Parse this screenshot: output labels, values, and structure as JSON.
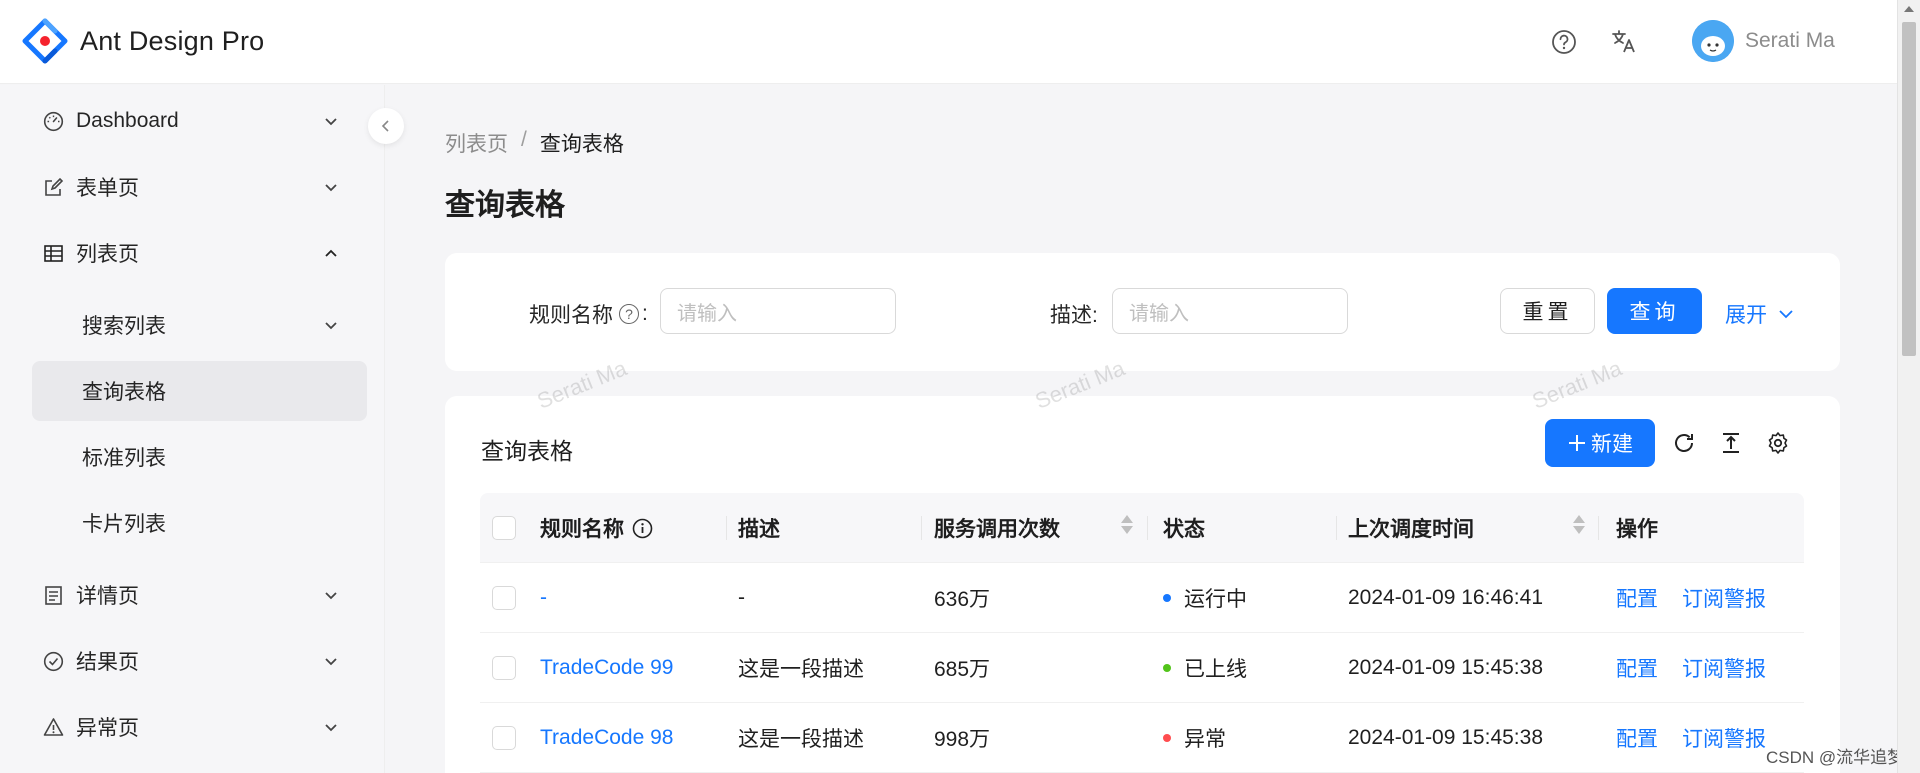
{
  "header": {
    "app_name": "Ant Design Pro",
    "username": "Serati Ma"
  },
  "sidebar": {
    "items": [
      {
        "label": "Dashboard"
      },
      {
        "label": "表单页"
      },
      {
        "label": "列表页"
      },
      {
        "label": "详情页"
      },
      {
        "label": "结果页"
      },
      {
        "label": "异常页"
      }
    ],
    "list_sub_items": [
      {
        "label": "搜索列表"
      },
      {
        "label": "查询表格"
      },
      {
        "label": "标准列表"
      },
      {
        "label": "卡片列表"
      }
    ]
  },
  "breadcrumb": {
    "parent": "列表页",
    "separator": "/",
    "current": "查询表格"
  },
  "page_title": "查询表格",
  "search_form": {
    "rule_name_label": "规则名称",
    "rule_name_suffix": ":",
    "rule_name_placeholder": "请输入",
    "desc_label": "描述:",
    "desc_placeholder": "请输入",
    "reset_label": "重置",
    "query_label": "查询",
    "expand_label": "展开"
  },
  "table_card": {
    "title": "查询表格",
    "new_label": "新建",
    "columns": {
      "rule_name": "规则名称",
      "desc": "描述",
      "call_count": "服务调用次数",
      "status": "状态",
      "last_time": "上次调度时间",
      "action": "操作"
    },
    "rows": [
      {
        "name": "-",
        "desc": "-",
        "calls": "636万",
        "status": "运行中",
        "status_color": "#1677ff",
        "time": "2024-01-09 16:46:41",
        "config": "配置",
        "subscribe": "订阅警报"
      },
      {
        "name": "TradeCode 99",
        "desc": "这是一段描述",
        "calls": "685万",
        "status": "已上线",
        "status_color": "#52c41a",
        "time": "2024-01-09 15:45:38",
        "config": "配置",
        "subscribe": "订阅警报"
      },
      {
        "name": "TradeCode 98",
        "desc": "这是一段描述",
        "calls": "998万",
        "status": "异常",
        "status_color": "#ff4d4f",
        "time": "2024-01-09 15:45:38",
        "config": "配置",
        "subscribe": "订阅警报"
      }
    ]
  },
  "watermark": "Serati Ma",
  "footer_credit": "CSDN @流华追梦",
  "colors": {
    "primary": "#1677ff",
    "success": "#52c41a",
    "error": "#ff4d4f"
  }
}
